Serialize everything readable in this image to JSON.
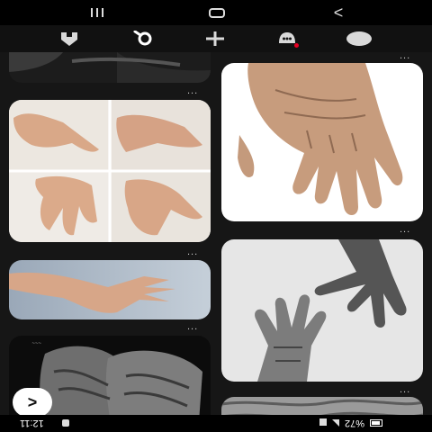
{
  "status_bar": {
    "time": "12:11",
    "battery_percent": "%72"
  },
  "nav_bar": {
    "recents_icon": "recents-icon",
    "home_icon": "home-button-icon",
    "back_icon": "back-triangle-icon"
  },
  "toolbar": {
    "items": [
      {
        "icon": "home-icon"
      },
      {
        "icon": "search-icon"
      },
      {
        "icon": "create-plus-icon"
      },
      {
        "icon": "notifications-icon"
      },
      {
        "icon": "profile-icon"
      }
    ],
    "colors": {
      "background": "#111111",
      "icon": "#d9d9d9",
      "notif_dot": "#e60023"
    }
  },
  "feed": {
    "more_label": "...",
    "pins": [
      {
        "id": "pin-top-partial",
        "subject": "dark hand photo"
      },
      {
        "id": "pin-hand-collage",
        "subject": "hand pose collage"
      },
      {
        "id": "pin-aged-hand",
        "subject": "aged hand"
      },
      {
        "id": "pin-reaching-arm",
        "subject": "reaching arm"
      },
      {
        "id": "pin-bw-hands",
        "subject": "black and white reaching hands"
      },
      {
        "id": "pin-wrinkled-hands",
        "subject": "wrinkled clasped hands"
      },
      {
        "id": "pin-skin-texture",
        "subject": "skin texture"
      }
    ]
  },
  "floating_back": {
    "icon": "chevron-back-icon",
    "label": ">"
  }
}
